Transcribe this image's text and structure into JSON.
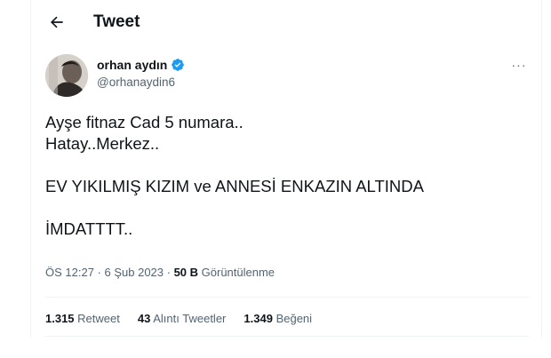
{
  "header": {
    "back_icon": "arrow-left-icon",
    "title": "Tweet"
  },
  "author": {
    "display_name": "orhan aydın",
    "handle": "@orhanaydin6",
    "verified": true,
    "verified_color": "#1d9bf0",
    "more_label": "···"
  },
  "tweet": {
    "lines": [
      "Ayşe fitnaz Cad 5 numara..",
      "Hatay..Merkez..",
      "",
      "EV YIKILMIŞ KIZIM ve ANNESİ ENKAZIN ALTINDA",
      "",
      "İMDATTTT.."
    ]
  },
  "meta": {
    "time": "ÖS 12:27",
    "separator": " · ",
    "date": "6 Şub 2023",
    "views_count": "50 B",
    "views_label": " Görüntülenme"
  },
  "stats": {
    "retweets_count": "1.315",
    "retweets_label": "Retweet",
    "quotes_count": "43",
    "quotes_label": "Alıntı Tweetler",
    "likes_count": "1.349",
    "likes_label": "Beğeni"
  }
}
